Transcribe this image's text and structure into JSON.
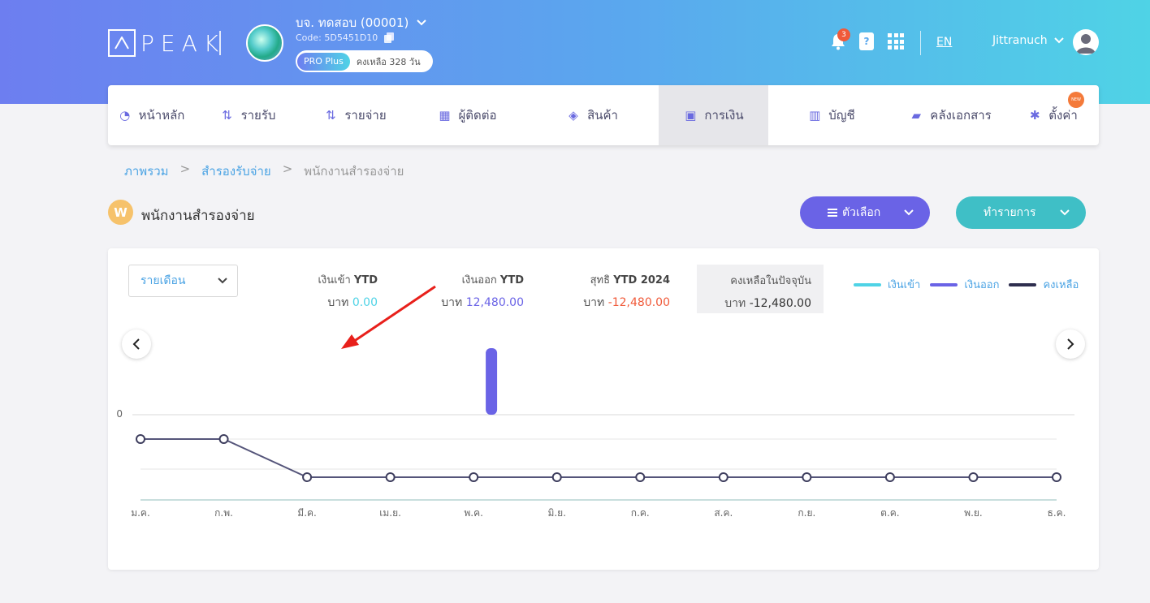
{
  "header": {
    "logo": "PEAK",
    "company_name": "บจ. ทดสอบ (00001)",
    "company_code": "Code: 5D5451D10",
    "plan_badge": "PRO Plus",
    "plan_remaining": "คงเหลือ 328 วัน",
    "notification_count": "3",
    "help_icon_text": "?",
    "language": "EN",
    "user_name": "Jittranuch"
  },
  "nav": {
    "items": [
      {
        "label": "หน้าหลัก",
        "icon": "chart-icon"
      },
      {
        "label": "รายรับ",
        "icon": "income-icon"
      },
      {
        "label": "รายจ่าย",
        "icon": "expense-icon"
      },
      {
        "label": "ผู้ติดต่อ",
        "icon": "contacts-icon"
      },
      {
        "label": "สินค้า",
        "icon": "box-icon"
      },
      {
        "label": "การเงิน",
        "icon": "money-icon"
      },
      {
        "label": "บัญชี",
        "icon": "ledger-icon"
      },
      {
        "label": "คลังเอกสาร",
        "icon": "folder-icon"
      },
      {
        "label": "ตั้งค่า",
        "icon": "gear-icon"
      }
    ],
    "active": "การเงิน",
    "new_badge": "NEW"
  },
  "breadcrumb": {
    "items": [
      "ภาพรวม",
      "สำรองรับจ่าย",
      "พนักงานสำรองจ่าย"
    ],
    "separator": ">"
  },
  "page": {
    "avatar_letter": "W",
    "title": "พนักงานสำรองจ่าย",
    "options_button": "ตัวเลือก",
    "action_button": "ทำรายการ"
  },
  "summary": {
    "period_select": "รายเดือน",
    "income_label": "เงินเข้า",
    "income_suffix": "YTD",
    "income_currency": "บาท",
    "income_value": "0.00",
    "expense_label": "เงินออก",
    "expense_suffix": "YTD",
    "expense_currency": "บาท",
    "expense_value": "12,480.00",
    "net_label": "สุทธิ",
    "net_suffix": "YTD 2024",
    "net_currency": "บาท",
    "net_value": "-12,480.00",
    "balance_label": "คงเหลือในปัจจุบัน",
    "balance_currency": "บาท",
    "balance_value": "-12,480.00"
  },
  "colors": {
    "income": "#4fd3e6",
    "expense": "#6a63e6",
    "balance": "#2e2e4e",
    "negative": "#f05a3a"
  },
  "chart_data": {
    "type": "bar",
    "categories": [
      "ม.ค.",
      "ก.พ.",
      "มี.ค.",
      "เม.ย.",
      "พ.ค.",
      "มิ.ย.",
      "ก.ค.",
      "ส.ค.",
      "ก.ย.",
      "ต.ค.",
      "พ.ย.",
      "ธ.ค."
    ],
    "series": [
      {
        "name": "เงินเข้า",
        "type": "bar",
        "values": [
          0,
          0,
          0,
          0,
          0,
          0,
          0,
          0,
          0,
          0,
          0,
          0
        ]
      },
      {
        "name": "เงินออก",
        "type": "bar",
        "values": [
          0,
          0,
          12480,
          0,
          0,
          0,
          0,
          0,
          0,
          0,
          0,
          0
        ]
      },
      {
        "name": "คงเหลือ",
        "type": "line",
        "values": [
          0,
          0,
          -12480,
          -12480,
          -12480,
          -12480,
          -12480,
          -12480,
          -12480,
          -12480,
          -12480,
          -12480
        ]
      }
    ],
    "y_tick_labels": [
      "0"
    ],
    "legend_position": "top-right"
  }
}
